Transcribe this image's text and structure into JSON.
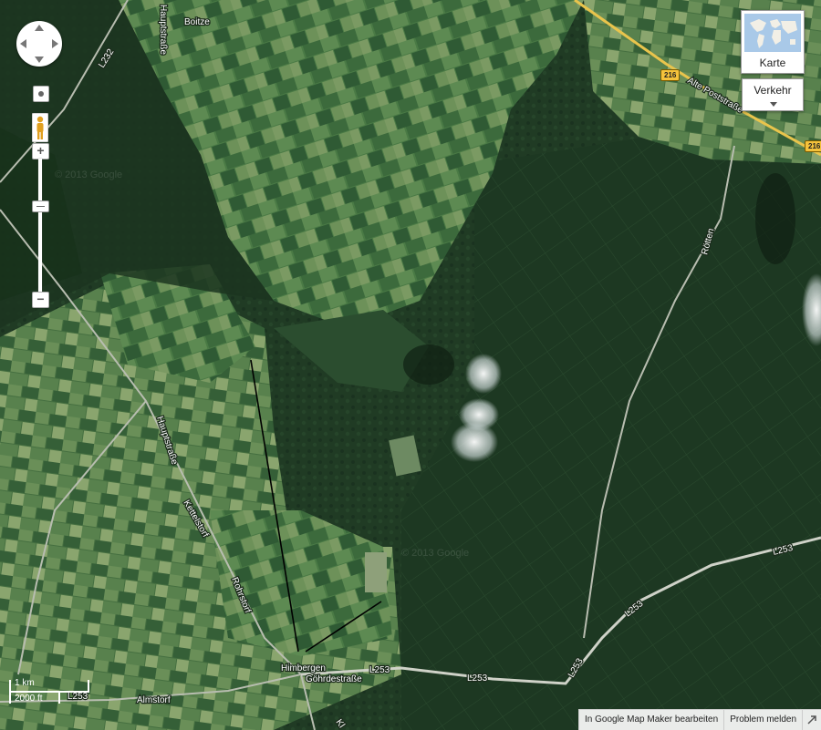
{
  "place_labels": {
    "boitze": "Boitze",
    "himbergen": "Himbergen",
    "almstorf": "Almstorf",
    "kettelstorf": "Kettelstorf",
    "rohrstorf": "Rohrstorf",
    "roetten": "Rötten"
  },
  "road_labels": {
    "hauptstrasse_top": "Hauptstraße",
    "l232": "L232",
    "hauptstrasse_left": "Hauptstraße",
    "alte_poststrasse": "Alte Poststraße",
    "goehrdestrasse": "Göhrdestraße",
    "l253_a": "L253",
    "l253_b": "L253",
    "l253_c": "L253",
    "l253_d": "L253",
    "l253_e": "L253",
    "l253_f": "L253",
    "kl": "Kl"
  },
  "road_shields": {
    "b216_a": "216",
    "b216_b": "216"
  },
  "controls": {
    "zoom_in": "+",
    "zoom_out": "−",
    "map_type": "Karte",
    "traffic": "Verkehr"
  },
  "scale": {
    "metric": "1 km",
    "imperial": "2000 ft"
  },
  "footer": {
    "edit_link": "In Google Map Maker bearbeiten",
    "report_link": "Problem melden"
  },
  "colors": {
    "forest": "#1f3a22",
    "field": "#3d6b3a",
    "road_major": "#e9c44c",
    "road_minor": "#b8bdb0"
  }
}
